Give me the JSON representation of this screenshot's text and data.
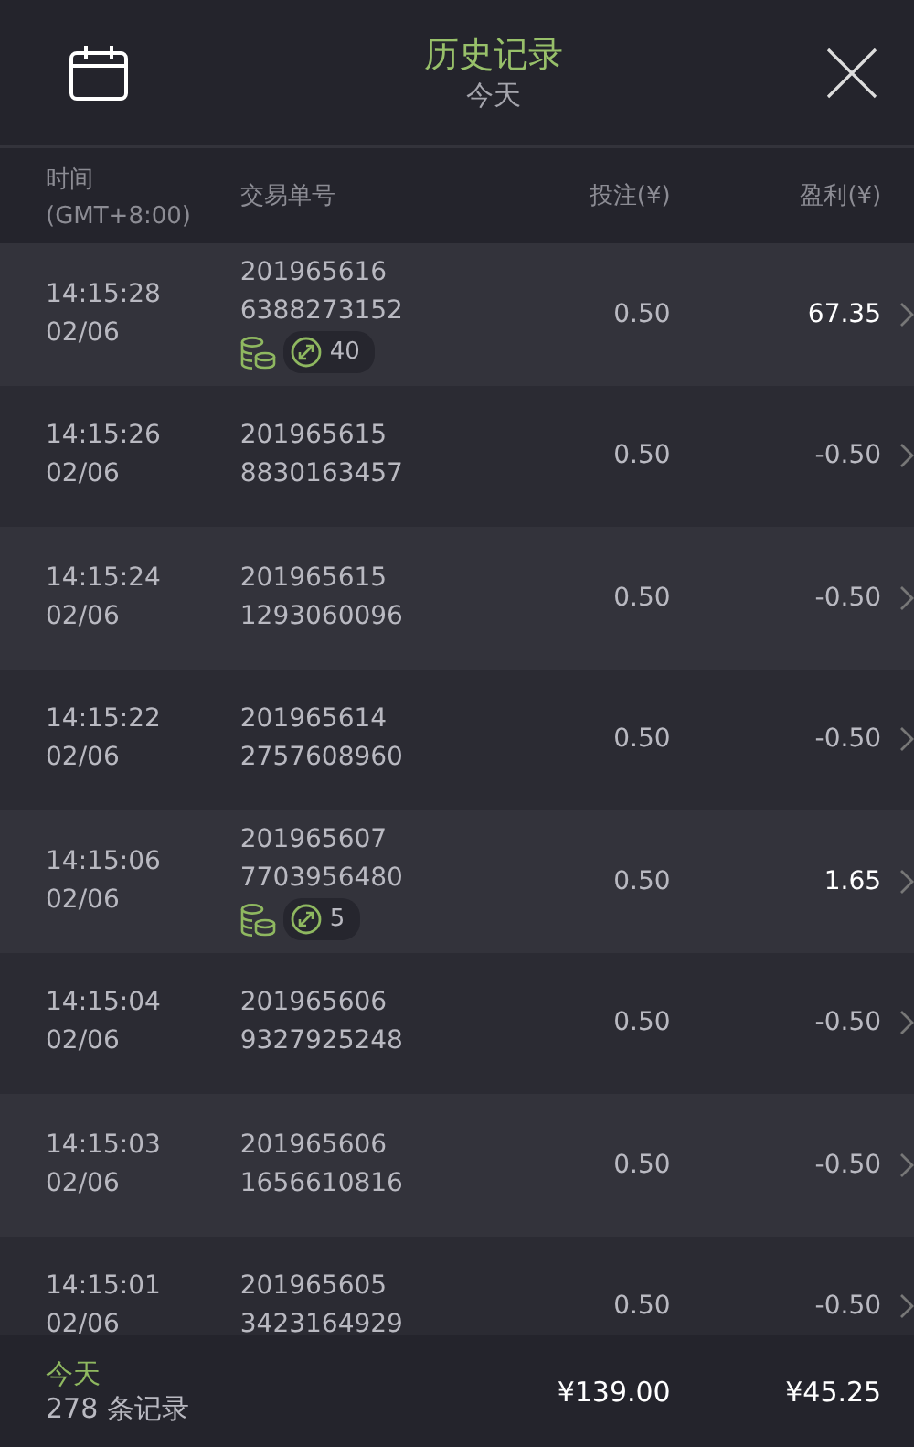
{
  "header": {
    "title": "历史记录",
    "subtitle": "今天"
  },
  "columns": [
    {
      "label": "时间",
      "sublabel": "(GMT+8:00)"
    },
    {
      "label": "交易单号"
    },
    {
      "label": "投注(¥)"
    },
    {
      "label": "盈利(¥)"
    }
  ],
  "rows": [
    {
      "time": "14:15:28",
      "date": "02/06",
      "id_1": "201965616",
      "id_2": "6388273152",
      "badge": "40",
      "stake": "0.50",
      "profit": "67.35",
      "win": true
    },
    {
      "time": "14:15:26",
      "date": "02/06",
      "id_1": "201965615",
      "id_2": "8830163457",
      "stake": "0.50",
      "profit": "-0.50",
      "win": false
    },
    {
      "time": "14:15:24",
      "date": "02/06",
      "id_1": "201965615",
      "id_2": "1293060096",
      "stake": "0.50",
      "profit": "-0.50",
      "win": false
    },
    {
      "time": "14:15:22",
      "date": "02/06",
      "id_1": "201965614",
      "id_2": "2757608960",
      "stake": "0.50",
      "profit": "-0.50",
      "win": false
    },
    {
      "time": "14:15:06",
      "date": "02/06",
      "id_1": "201965607",
      "id_2": "7703956480",
      "badge": "5",
      "stake": "0.50",
      "profit": "1.65",
      "win": true
    },
    {
      "time": "14:15:04",
      "date": "02/06",
      "id_1": "201965606",
      "id_2": "9327925248",
      "stake": "0.50",
      "profit": "-0.50",
      "win": false
    },
    {
      "time": "14:15:03",
      "date": "02/06",
      "id_1": "201965606",
      "id_2": "1656610816",
      "stake": "0.50",
      "profit": "-0.50",
      "win": false
    },
    {
      "time": "14:15:01",
      "date": "02/06",
      "id_1": "201965605",
      "id_2": "3423164929",
      "stake": "0.50",
      "profit": "-0.50",
      "win": false
    }
  ],
  "footer": {
    "period": "今天",
    "count": "278 条记录",
    "total_stake": "¥139.00",
    "total_profit": "¥45.25"
  }
}
